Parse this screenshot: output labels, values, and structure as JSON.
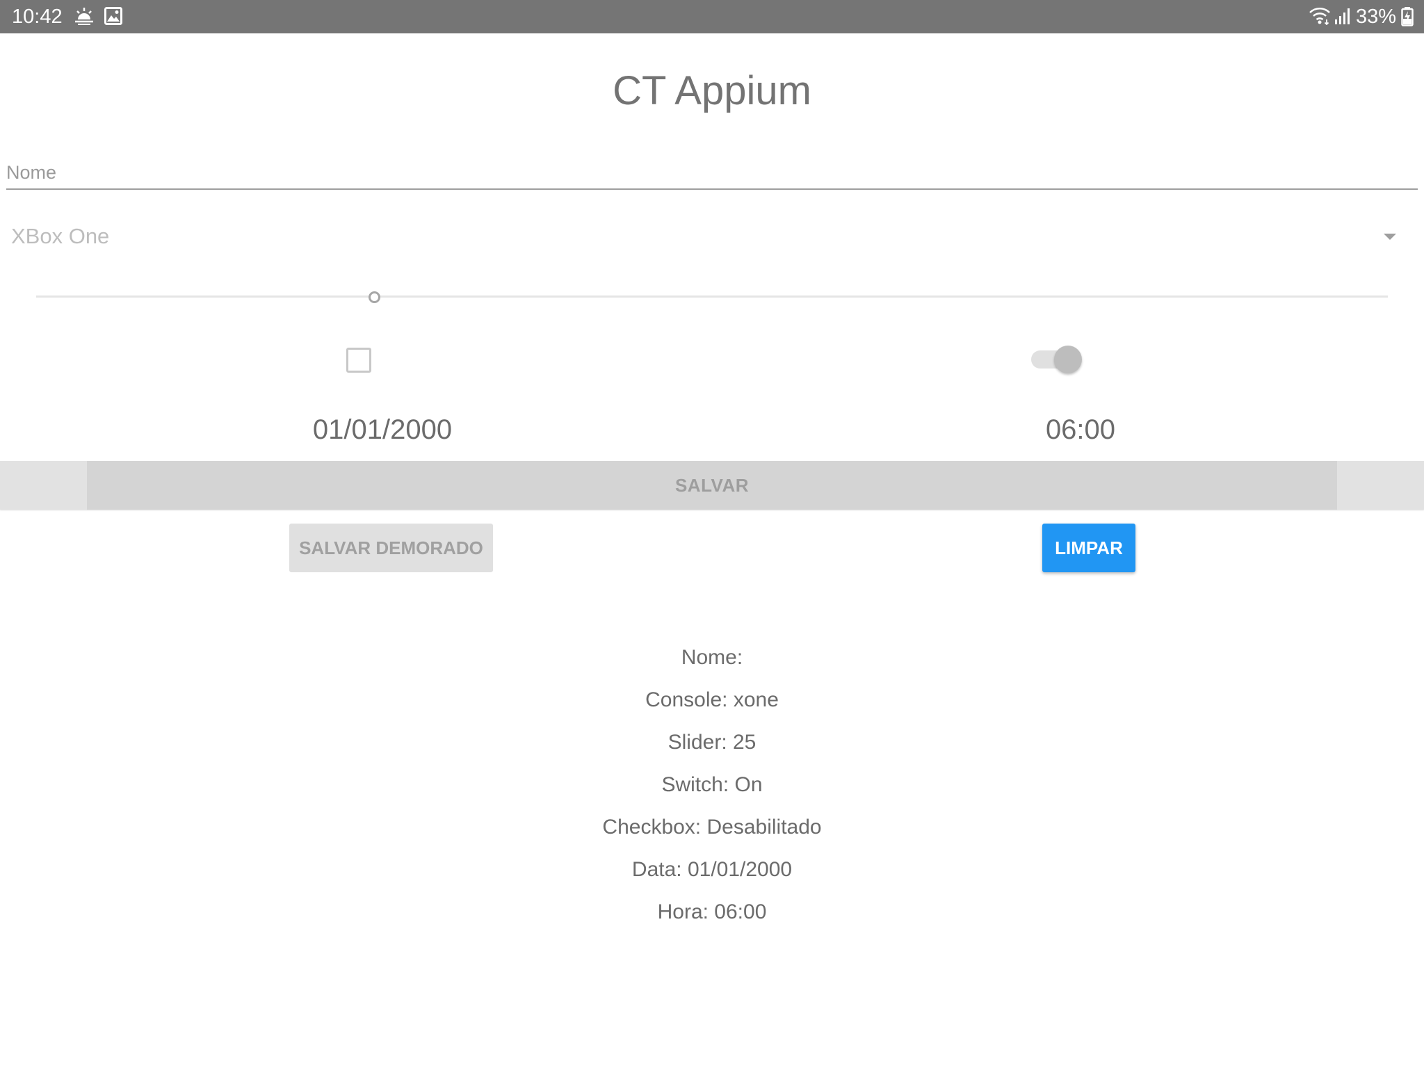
{
  "status_bar": {
    "time": "10:42",
    "battery": "33%",
    "icons": [
      "weather-sunrise-icon",
      "gallery-icon",
      "wifi-icon",
      "signal-icon",
      "battery-charging-icon"
    ]
  },
  "app": {
    "title": "CT Appium"
  },
  "form": {
    "name_placeholder": "Nome",
    "name_value": "",
    "console_selected": "XBox One",
    "slider_value": 25,
    "slider_max": 100,
    "checkbox_checked": false,
    "switch_on": true,
    "date": "01/01/2000",
    "time": "06:00"
  },
  "buttons": {
    "save": "SALVAR",
    "save_delayed": "SALVAR DEMORADO",
    "clear": "LIMPAR"
  },
  "results": {
    "name": "Nome:",
    "console": "Console: xone",
    "slider": "Slider: 25",
    "switch": "Switch: On",
    "checkbox": "Checkbox: Desabilitado",
    "date": "Data: 01/01/2000",
    "time": "Hora: 06:00"
  },
  "colors": {
    "status_bar": "#757575",
    "accent_blue": "#2196f3",
    "disabled_button": "#d4d4d4",
    "text_gray": "#6b6b6b"
  }
}
